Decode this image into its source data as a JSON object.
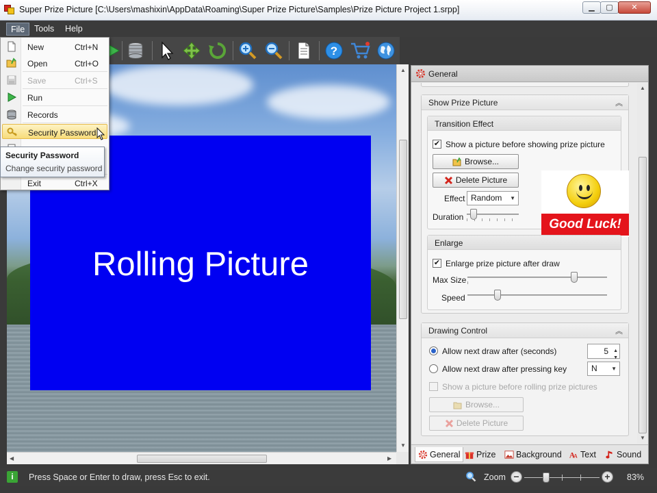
{
  "window": {
    "title": "Super Prize Picture [C:\\Users\\mashixin\\AppData\\Roaming\\Super Prize Picture\\Samples\\Prize Picture Project 1.srpp]",
    "minimize": "▁",
    "maximize": "▢",
    "close": "✕"
  },
  "menubar": {
    "file": "File",
    "tools": "Tools",
    "help": "Help"
  },
  "file_menu": {
    "items": [
      {
        "label": "New",
        "shortcut": "Ctrl+N",
        "icon": "new-document-icon",
        "enabled": true
      },
      {
        "label": "Open",
        "shortcut": "Ctrl+O",
        "icon": "open-folder-icon",
        "enabled": true
      },
      {
        "label": "Save",
        "shortcut": "Ctrl+S",
        "icon": "save-disk-icon",
        "enabled": false
      },
      {
        "label": "Run",
        "shortcut": "",
        "icon": "run-play-icon",
        "enabled": true
      },
      {
        "label": "Records",
        "shortcut": "",
        "icon": "records-database-icon",
        "enabled": true
      },
      {
        "label": "Security Password",
        "shortcut": "",
        "icon": "key-icon",
        "enabled": true,
        "highlighted": true
      },
      {
        "label": "Exit",
        "shortcut": "Ctrl+X",
        "icon": "",
        "enabled": true
      }
    ]
  },
  "tooltip": {
    "title": "Security Password",
    "description": "Change security password"
  },
  "toolbar": {
    "icons": [
      "run-icon",
      "records-database-icon",
      "pointer-select-icon",
      "move-icon",
      "rotate-icon",
      "zoom-in-icon",
      "zoom-out-icon",
      "page-icon",
      "help-icon",
      "shopping-cart-icon",
      "web-globe-icon"
    ]
  },
  "canvas": {
    "rolling_text": "Rolling Picture",
    "rolling_bg": "#0000f2"
  },
  "panel": {
    "header": "General",
    "show_prize": {
      "title": "Show Prize Picture",
      "transition": {
        "title": "Transition Effect",
        "show_before_label": "Show a picture before showing prize picture",
        "show_before_checked": true,
        "browse": "Browse...",
        "delete": "Delete Picture",
        "effect_label": "Effect",
        "effect_value": "Random",
        "duration_label": "Duration",
        "duration_level": 0.08,
        "image_text": "Good Luck!"
      },
      "enlarge": {
        "title": "Enlarge",
        "enlarge_label": "Enlarge prize picture after draw",
        "enlarge_checked": true,
        "max_size_label": "Max Size",
        "max_size_level": 0.78,
        "speed_label": "Speed",
        "speed_level": 0.2
      }
    },
    "drawing_control": {
      "title": "Drawing Control",
      "allow_after_seconds_label": "Allow next draw after (seconds)",
      "seconds_value": "5",
      "allow_after_key_label": "Allow next draw after pressing key",
      "key_value": "N",
      "show_before_rolling_label": "Show a picture before rolling prize pictures",
      "browse": "Browse...",
      "delete": "Delete Picture"
    },
    "tabs": [
      {
        "label": "General",
        "icon": "gear-icon",
        "active": true
      },
      {
        "label": "Prize",
        "icon": "gift-icon",
        "active": false
      },
      {
        "label": "Background",
        "icon": "picture-icon",
        "active": false
      },
      {
        "label": "Text",
        "icon": "text-icon",
        "active": false
      },
      {
        "label": "Sound",
        "icon": "music-note-icon",
        "active": false
      }
    ]
  },
  "statusbar": {
    "message": "Press Space or Enter to draw, press Esc to exit.",
    "zoom_label": "Zoom",
    "zoom_value": "83%",
    "zoom_level": 0.27
  }
}
